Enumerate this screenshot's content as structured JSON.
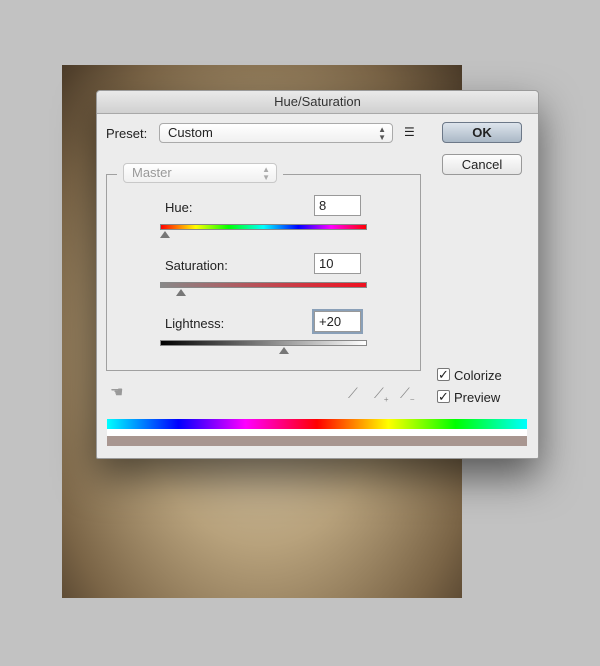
{
  "dialog": {
    "title": "Hue/Saturation"
  },
  "preset": {
    "label": "Preset:",
    "value": "Custom",
    "menu_icon": "list-options-icon"
  },
  "buttons": {
    "ok": "OK",
    "cancel": "Cancel"
  },
  "channel": {
    "value": "Master"
  },
  "hue": {
    "label": "Hue:",
    "value": "8",
    "min": 0,
    "max": 360,
    "level": 8
  },
  "saturation": {
    "label": "Saturation:",
    "value": "10",
    "min": 0,
    "max": 100,
    "level": 10
  },
  "lightness": {
    "label": "Lightness:",
    "value": "+20",
    "min": -100,
    "max": 100,
    "level": 20
  },
  "checkboxes": {
    "colorize": {
      "label": "Colorize",
      "checked": true
    },
    "preview": {
      "label": "Preview",
      "checked": true
    }
  },
  "icons": {
    "adjust": "targeted-adjustment-hand-icon",
    "eyedroppers": [
      "eyedropper-icon",
      "eyedropper-plus-icon",
      "eyedropper-minus-icon"
    ]
  },
  "colors": {
    "result_bar": "#a89690",
    "accent": "#8aa0b8"
  }
}
